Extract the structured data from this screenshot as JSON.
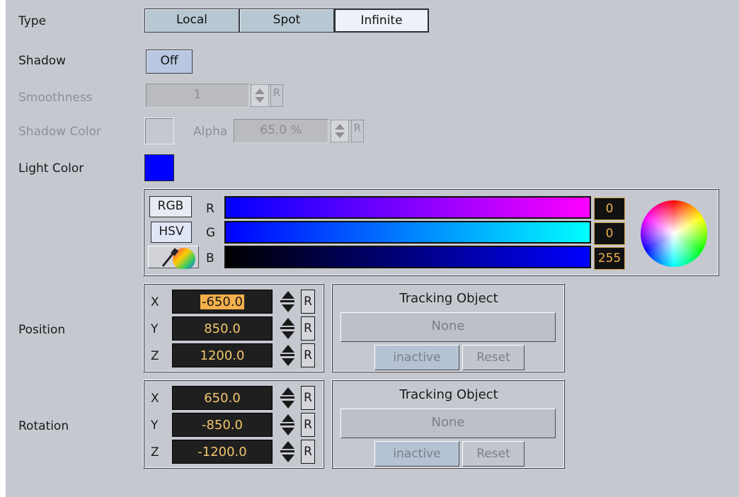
{
  "labels": {
    "type": "Type",
    "shadow": "Shadow",
    "smoothness": "Smoothness",
    "shadow_color": "Shadow Color",
    "alpha": "Alpha",
    "light_color": "Light Color",
    "position": "Position",
    "rotation": "Rotation"
  },
  "type_tabs": [
    "Local",
    "Spot",
    "Infinite"
  ],
  "selected_type": "Infinite",
  "shadow": {
    "value": "Off"
  },
  "smoothness": {
    "value": "1",
    "reset": "R"
  },
  "shadow_color": {
    "alpha": "65.0 %",
    "reset": "R"
  },
  "light_color": {
    "hex": "#0000ff",
    "modes": [
      "RGB",
      "HSV"
    ],
    "channels": [
      {
        "name": "R",
        "value": "0"
      },
      {
        "name": "G",
        "value": "0"
      },
      {
        "name": "B",
        "value": "255"
      }
    ]
  },
  "position": {
    "rows": [
      {
        "axis": "X",
        "value": "-650.0",
        "reset": "R"
      },
      {
        "axis": "Y",
        "value": "850.0",
        "reset": "R"
      },
      {
        "axis": "Z",
        "value": "1200.0",
        "reset": "R"
      }
    ],
    "tracking": {
      "title": "Tracking Object",
      "object": "None",
      "state": "inactive",
      "reset": "Reset"
    }
  },
  "rotation": {
    "rows": [
      {
        "axis": "X",
        "value": "650.0",
        "reset": "R"
      },
      {
        "axis": "Y",
        "value": "-850.0",
        "reset": "R"
      },
      {
        "axis": "Z",
        "value": "-1200.0",
        "reset": "R"
      }
    ],
    "tracking": {
      "title": "Tracking Object",
      "object": "None",
      "state": "inactive",
      "reset": "Reset"
    }
  }
}
